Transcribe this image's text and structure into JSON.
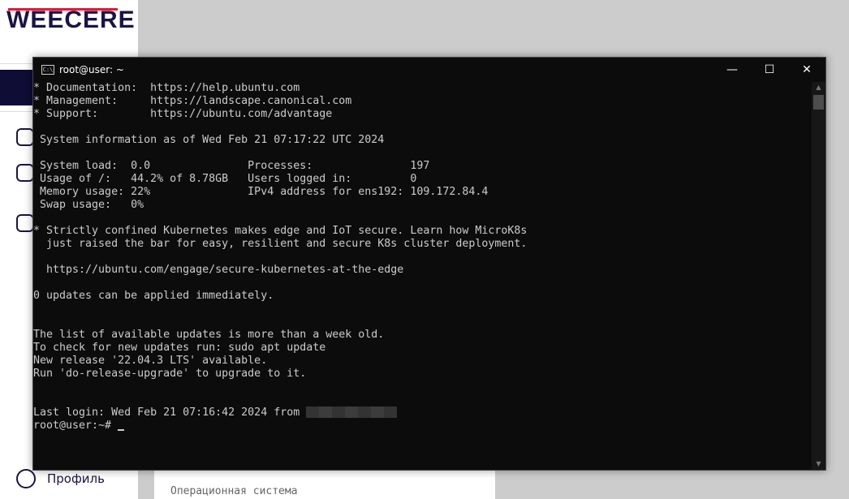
{
  "brand": {
    "logo": "WEECERE"
  },
  "sidebar": {
    "profile_label": "Профиль"
  },
  "content": {
    "os_label": "Операционная система"
  },
  "terminal": {
    "title": "root@user: ~",
    "lines": [
      "* Documentation:  https://help.ubuntu.com",
      "* Management:     https://landscape.canonical.com",
      "* Support:        https://ubuntu.com/advantage",
      "",
      " System information as of Wed Feb 21 07:17:22 UTC 2024",
      "",
      " System load:  0.0               Processes:               197",
      " Usage of /:   44.2% of 8.78GB   Users logged in:         0",
      " Memory usage: 22%               IPv4 address for ens192: 109.172.84.4",
      " Swap usage:   0%",
      "",
      "* Strictly confined Kubernetes makes edge and IoT secure. Learn how MicroK8s",
      "  just raised the bar for easy, resilient and secure K8s cluster deployment.",
      "",
      "  https://ubuntu.com/engage/secure-kubernetes-at-the-edge",
      "",
      "0 updates can be applied immediately.",
      "",
      "",
      "The list of available updates is more than a week old.",
      "To check for new updates run: sudo apt update",
      "New release '22.04.3 LTS' available.",
      "Run 'do-release-upgrade' to upgrade to it.",
      "",
      ""
    ],
    "last_login": "Last login: Wed Feb 21 07:16:42 2024 from ",
    "prompt": "root@user:~# "
  }
}
